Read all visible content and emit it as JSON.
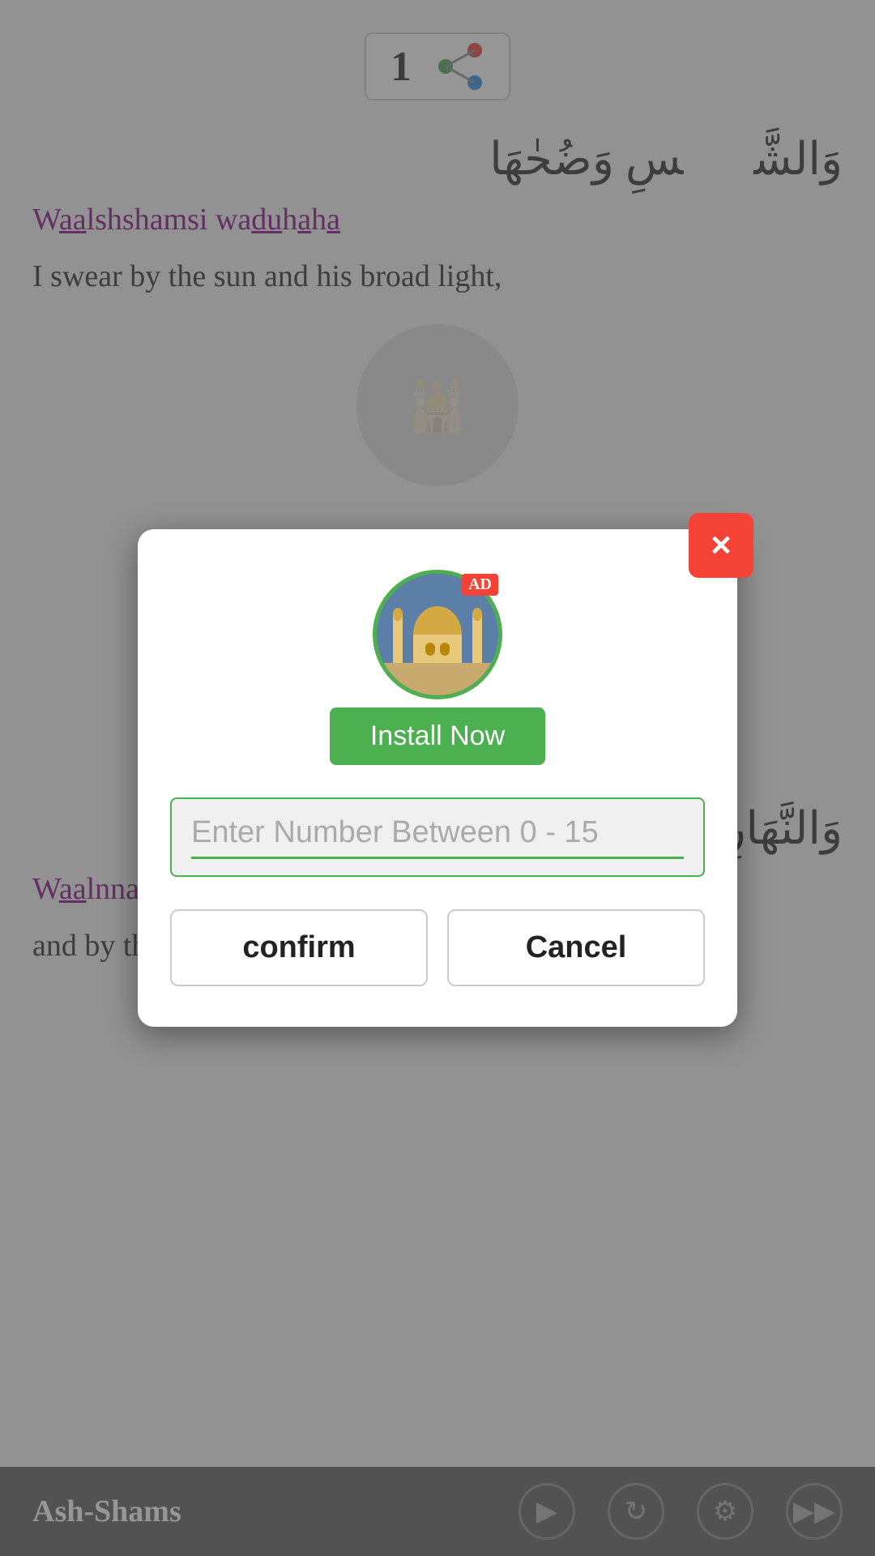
{
  "app": {
    "title": "Ash-Shams"
  },
  "top": {
    "counter": "1",
    "share_icon_label": "share"
  },
  "verse1": {
    "arabic": "وَالشَّمۡسِ وَضُحٰهَا",
    "transliteration_parts": [
      {
        "text": "W",
        "underline": false
      },
      {
        "text": "aa",
        "underline": true
      },
      {
        "text": "lshshamsi wa",
        "underline": false
      },
      {
        "text": "du",
        "underline": true
      },
      {
        "text": "h",
        "underline": false
      },
      {
        "text": "a",
        "underline": true
      },
      {
        "text": "h",
        "underline": false
      },
      {
        "text": "a",
        "underline": true
      }
    ],
    "transliteration_display": "Waalshshamsi waduhaha",
    "translation": "I swear by the sun and his broad light,"
  },
  "dialog": {
    "ad_badge": "AD",
    "install_now": "Install Now",
    "close_icon": "×",
    "input_placeholder": "Enter Number Between 0 - 15",
    "confirm_label": "confirm",
    "cancel_label": "Cancel"
  },
  "verse2": {
    "arabic": "وَالنَّهَارِ إِذَا جَلّٰهَا",
    "transliteration": "Waalnnahari itha jallaha",
    "translation": "and by the day when it shows its brightness,"
  },
  "bottom_nav": {
    "title": "Ash-Shams",
    "icons": [
      "play",
      "refresh",
      "settings",
      "go"
    ]
  }
}
